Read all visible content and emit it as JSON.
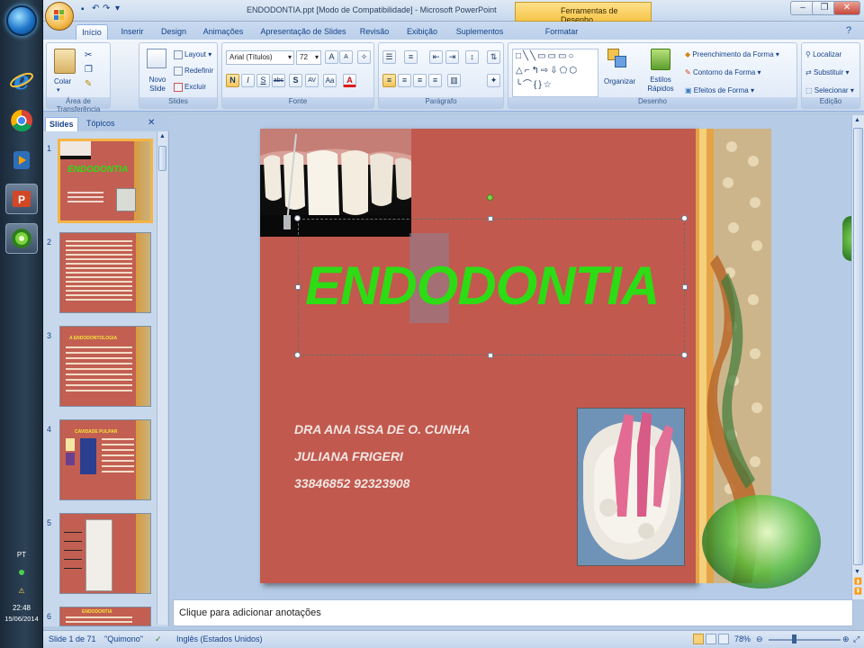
{
  "app": {
    "title": "ENDODONTIA.ppt [Modo de Compatibilidade] - Microsoft PowerPoint",
    "context_tab_header": "Ferramentas de Desenho"
  },
  "taskbar": {
    "language": "PT",
    "time": "22:48",
    "date": "15/06/2014"
  },
  "tabs": [
    "Início",
    "Inserir",
    "Design",
    "Animações",
    "Apresentação de Slides",
    "Revisão",
    "Exibição",
    "Suplementos",
    "Formatar"
  ],
  "ribbon": {
    "clipboard": {
      "paste": "Colar",
      "group": "Área de Transferência"
    },
    "slides": {
      "new_slide": "Novo Slide",
      "layout": "Layout",
      "reset": "Redefinir",
      "delete": "Excluir",
      "group": "Slides"
    },
    "font": {
      "font_name": "Arial (Títulos)",
      "font_size": "72",
      "bold": "N",
      "italic": "I",
      "underline": "S",
      "strike": "abc",
      "shadow": "S",
      "group": "Fonte"
    },
    "paragraph": {
      "group": "Parágrafo"
    },
    "drawing": {
      "arrange": "Organizar",
      "quick_styles": "Estilos Rápidos",
      "fill": "Preenchimento da Forma",
      "outline": "Contorno da Forma",
      "effects": "Efeitos de Forma",
      "group": "Desenho"
    },
    "editing": {
      "find": "Localizar",
      "replace": "Substituir",
      "select": "Selecionar",
      "group": "Edição"
    }
  },
  "left_pane": {
    "tab_slides": "Slides",
    "tab_outline": "Tópicos",
    "thumbnails": [
      {
        "num": "1",
        "title": "ENDODONTIA"
      },
      {
        "num": "2",
        "title": ""
      },
      {
        "num": "3",
        "title": "A ENDODONTOLOGIA"
      },
      {
        "num": "4",
        "title": "CAVIDADE PULPAR"
      },
      {
        "num": "5",
        "title": ""
      },
      {
        "num": "6",
        "title": "ENDODONTIA"
      }
    ]
  },
  "slide": {
    "title": "ENDODONTIA",
    "authors": "DRA ANA ISSA DE O. CUNHA",
    "author2": "JULIANA FRIGERI",
    "phones": "33846852   92323908"
  },
  "notes_placeholder": "Clique para adicionar anotações",
  "status": {
    "slide_info": "Slide 1 de 71",
    "theme": "\"Quimono\"",
    "language": "Inglês (Estados Unidos)",
    "zoom": "78%"
  }
}
